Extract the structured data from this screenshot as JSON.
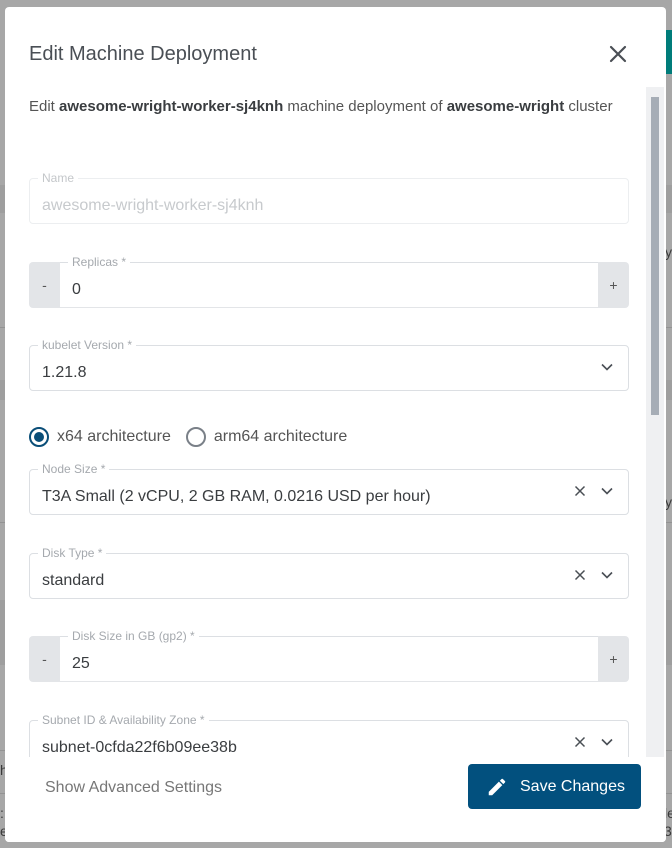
{
  "background": {
    "fragments": [
      "y",
      "y",
      "h",
      ":",
      "e",
      "le",
      "3:"
    ]
  },
  "dialog": {
    "title": "Edit Machine Deployment",
    "close_icon": "close-icon",
    "description": {
      "prefix": "Edit ",
      "machine_deployment": "awesome-wright-worker-sj4knh",
      "middle": " machine deployment of ",
      "cluster": "awesome-wright",
      "suffix": " cluster"
    },
    "fields": {
      "name": {
        "label": "Name",
        "value": "awesome-wright-worker-sj4knh",
        "disabled": true
      },
      "replicas": {
        "label": "Replicas *",
        "value": "0",
        "minus": "-",
        "plus": "+"
      },
      "kubelet_version": {
        "label": "kubelet Version *",
        "value": "1.21.8"
      },
      "architecture": {
        "options": [
          {
            "label": "x64 architecture",
            "checked": true
          },
          {
            "label": "arm64 architecture",
            "checked": false
          }
        ]
      },
      "node_size": {
        "label": "Node Size *",
        "value": "T3A Small (2 vCPU, 2 GB RAM, 0.0216 USD per hour)"
      },
      "disk_type": {
        "label": "Disk Type *",
        "value": "standard"
      },
      "disk_size": {
        "label": "Disk Size in GB (gp2) *",
        "value": "25",
        "minus": "-",
        "plus": "+"
      },
      "subnet": {
        "label": "Subnet ID & Availability Zone *",
        "value": "subnet-0cfda22f6b09ee38b"
      }
    },
    "footer": {
      "advanced_link": "Show Advanced Settings",
      "save_label": "Save Changes",
      "save_icon": "pencil-icon"
    }
  },
  "colors": {
    "primary": "#02507e",
    "radio_checked": "#0a4e78",
    "overlay": "#a7a7a7",
    "bg_teal": "#007c7a"
  }
}
